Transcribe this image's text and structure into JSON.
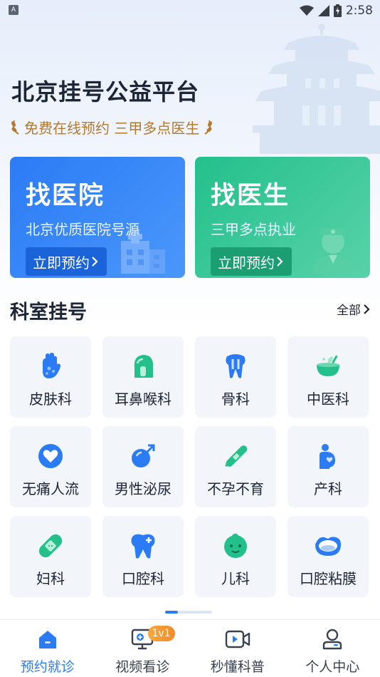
{
  "status_bar": {
    "time": "2:58",
    "notification_glyph": "A"
  },
  "header": {
    "title": "北京挂号公益平台",
    "subtitle": "免费在线预约 三甲多点医生"
  },
  "cards": [
    {
      "title": "找医院",
      "desc": "北京优质医院号源",
      "button": "立即预约"
    },
    {
      "title": "找医生",
      "desc": "三甲多点执业",
      "button": "立即预约"
    }
  ],
  "section": {
    "title": "科室挂号",
    "more": "全部"
  },
  "departments": [
    {
      "label": "皮肤科",
      "icon": "skin-hand-icon"
    },
    {
      "label": "耳鼻喉科",
      "icon": "ent-head-icon"
    },
    {
      "label": "骨科",
      "icon": "bone-tooth-icon"
    },
    {
      "label": "中医科",
      "icon": "mortar-herb-icon"
    },
    {
      "label": "无痛人流",
      "icon": "heart-circle-icon"
    },
    {
      "label": "男性泌尿",
      "icon": "male-symbol-icon"
    },
    {
      "label": "不孕不育",
      "icon": "pregnancy-test-icon"
    },
    {
      "label": "产科",
      "icon": "pregnant-woman-icon"
    },
    {
      "label": "妇科",
      "icon": "band-aid-icon"
    },
    {
      "label": "口腔科",
      "icon": "tooth-plus-icon"
    },
    {
      "label": "儿科",
      "icon": "baby-face-icon"
    },
    {
      "label": "口腔粘膜",
      "icon": "mouth-lips-icon"
    }
  ],
  "bottom_nav": [
    {
      "label": "预约就诊",
      "icon": "home-icon",
      "active": true
    },
    {
      "label": "视频看诊",
      "icon": "video-consult-icon",
      "badge": "1v1"
    },
    {
      "label": "秒懂科普",
      "icon": "video-camera-icon"
    },
    {
      "label": "个人中心",
      "icon": "person-icon"
    }
  ],
  "colors": {
    "primary": "#2b7bf5",
    "green": "#23c08c",
    "gold": "#b37a2e",
    "badge": "#f18b2c"
  }
}
